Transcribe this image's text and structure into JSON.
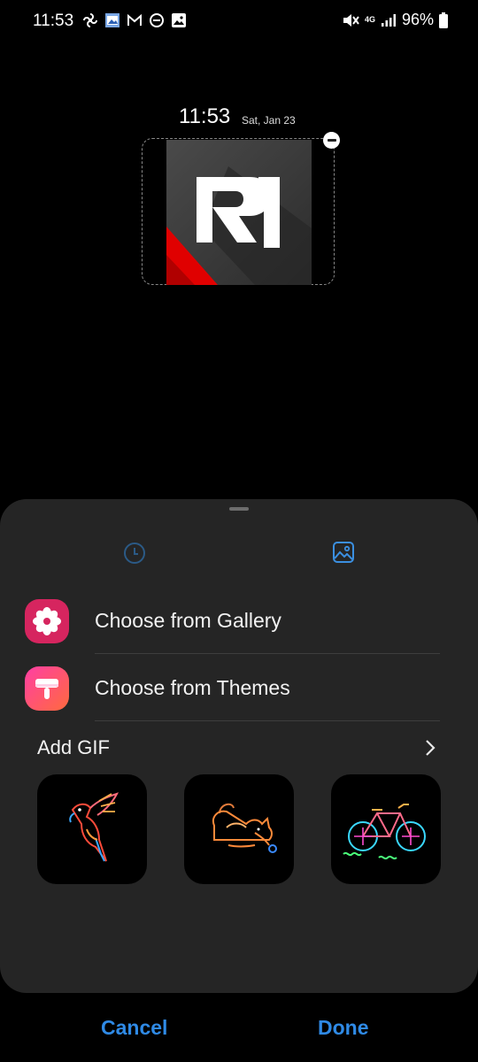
{
  "status_bar": {
    "time": "11:53",
    "network": "4G",
    "battery": "96%",
    "icons": [
      "pinwheel-icon",
      "photo-app-icon",
      "gmail-icon",
      "dnd-icon",
      "gallery-icon",
      "mute-icon",
      "signal-icon",
      "battery-icon"
    ]
  },
  "preview": {
    "time": "11:53",
    "date": "Sat, Jan 23"
  },
  "sheet": {
    "tabs": [
      {
        "name": "clock-tab",
        "icon": "clock-icon",
        "active": false
      },
      {
        "name": "image-tab",
        "icon": "image-icon",
        "active": true
      }
    ],
    "options": [
      {
        "label": "Choose from Gallery",
        "icon": "gallery-flower-icon"
      },
      {
        "label": "Choose from Themes",
        "icon": "themes-brush-icon"
      }
    ],
    "gif_section": {
      "title": "Add GIF",
      "items": [
        "neon-parrot",
        "neon-cat",
        "neon-bicycle"
      ]
    }
  },
  "footer": {
    "cancel": "Cancel",
    "done": "Done"
  },
  "colors": {
    "accent": "#2f8ae6",
    "sheet_bg": "#252525"
  }
}
